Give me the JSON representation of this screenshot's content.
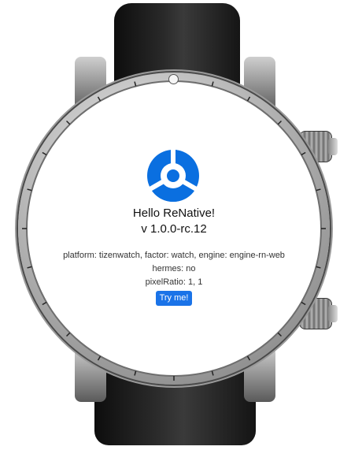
{
  "app": {
    "title": "Hello ReNative!",
    "version": "v 1.0.0-rc.12"
  },
  "info": {
    "platform_line": "platform: tizenwatch, factor: watch, engine: engine-rn-web",
    "hermes_line": "hermes: no",
    "pixel_ratio_line": "pixelRatio: 1, 1"
  },
  "actions": {
    "try_label": "Try me!"
  },
  "icons": {
    "logo": "renative-logo-icon"
  },
  "colors": {
    "accent": "#1a73e8",
    "logo": "#0a6fe0"
  }
}
